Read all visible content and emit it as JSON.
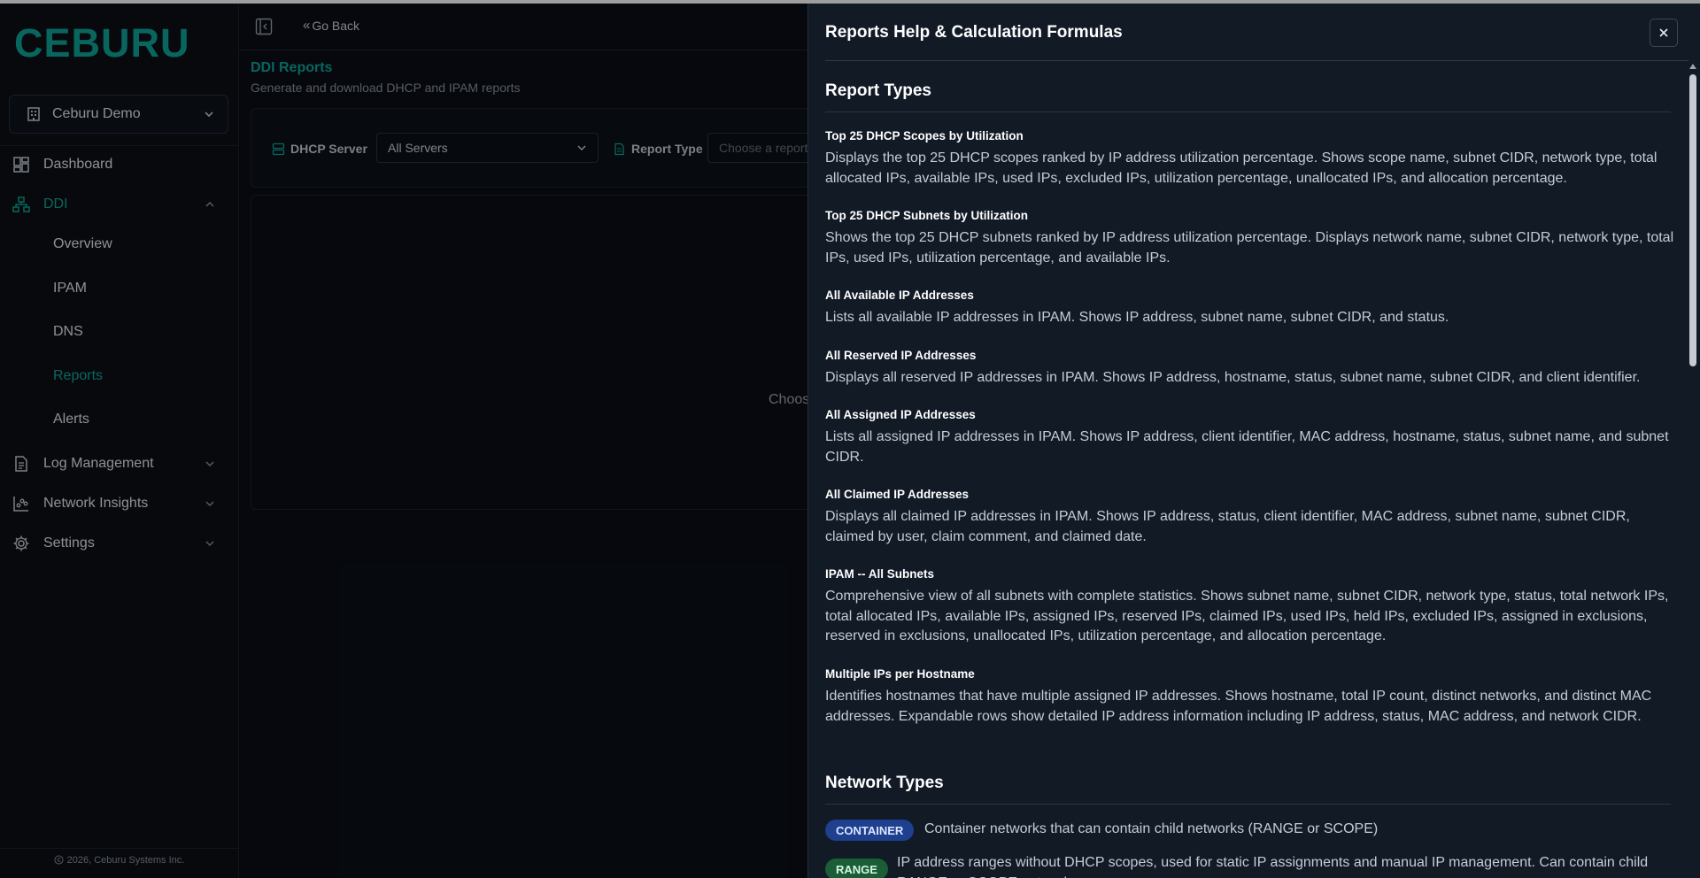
{
  "app": {
    "logo_text": "CEBURU",
    "brand_color": "#0fa59a"
  },
  "sidebar": {
    "org_selector": "Ceburu Demo",
    "nav": [
      {
        "label": "Dashboard",
        "icon": "dashboard-icon"
      },
      {
        "label": "DDI",
        "icon": "network-icon",
        "active": true
      },
      {
        "label": "Log Management",
        "icon": "file-icon"
      },
      {
        "label": "Network Insights",
        "icon": "insights-icon"
      },
      {
        "label": "Settings",
        "icon": "gear-icon"
      }
    ],
    "ddi_children": [
      "Overview",
      "IPAM",
      "DNS",
      "Reports",
      "Alerts"
    ],
    "active_child": "Reports",
    "footer": "2026, Ceburu Systems Inc."
  },
  "header": {
    "go_back": "Go Back"
  },
  "page": {
    "title": "DDI Reports",
    "subtitle": "Generate and download DHCP and IPAM reports",
    "filters": {
      "dhcp_label": "DHCP Server",
      "dhcp_value": "All Servers",
      "report_label": "Report Type",
      "report_placeholder": "Choose a report"
    },
    "empty_message": "Choose"
  },
  "help_panel": {
    "title": "Reports Help & Calculation Formulas",
    "report_types_heading": "Report Types",
    "report_types": [
      {
        "title": "Top 25 DHCP Scopes by Utilization",
        "description": "Displays the top 25 DHCP scopes ranked by IP address utilization percentage. Shows scope name, subnet CIDR, network type, total allocated IPs, available IPs, used IPs, excluded IPs, utilization percentage, unallocated IPs, and allocation percentage."
      },
      {
        "title": "Top 25 DHCP Subnets by Utilization",
        "description": "Shows the top 25 DHCP subnets ranked by IP address utilization percentage. Displays network name, subnet CIDR, network type, total IPs, used IPs, utilization percentage, and available IPs."
      },
      {
        "title": "All Available IP Addresses",
        "description": "Lists all available IP addresses in IPAM. Shows IP address, subnet name, subnet CIDR, and status."
      },
      {
        "title": "All Reserved IP Addresses",
        "description": "Displays all reserved IP addresses in IPAM. Shows IP address, hostname, status, subnet name, subnet CIDR, and client identifier."
      },
      {
        "title": "All Assigned IP Addresses",
        "description": "Lists all assigned IP addresses in IPAM. Shows IP address, client identifier, MAC address, hostname, status, subnet name, and subnet CIDR."
      },
      {
        "title": "All Claimed IP Addresses",
        "description": "Displays all claimed IP addresses in IPAM. Shows IP address, status, client identifier, MAC address, subnet name, subnet CIDR, claimed by user, claim comment, and claimed date."
      },
      {
        "title": "IPAM -- All Subnets",
        "description": "Comprehensive view of all subnets with complete statistics. Shows subnet name, subnet CIDR, network type, status, total network IPs, total allocated IPs, available IPs, assigned IPs, reserved IPs, claimed IPs, used IPs, held IPs, excluded IPs, assigned in exclusions, reserved in exclusions, unallocated IPs, utilization percentage, and allocation percentage."
      },
      {
        "title": "Multiple IPs per Hostname",
        "description": "Identifies hostnames that have multiple assigned IP addresses. Shows hostname, total IP count, distinct networks, and distinct MAC addresses. Expandable rows show detailed IP address information including IP address, status, MAC address, and network CIDR."
      }
    ],
    "network_types_heading": "Network Types",
    "network_types": [
      {
        "badge": "CONTAINER",
        "description": "Container networks that can contain child networks (RANGE or SCOPE)"
      },
      {
        "badge": "RANGE",
        "description": "IP address ranges without DHCP scopes, used for static IP assignments and manual IP management. Can contain child RANGE or SCOPE networks."
      }
    ]
  }
}
